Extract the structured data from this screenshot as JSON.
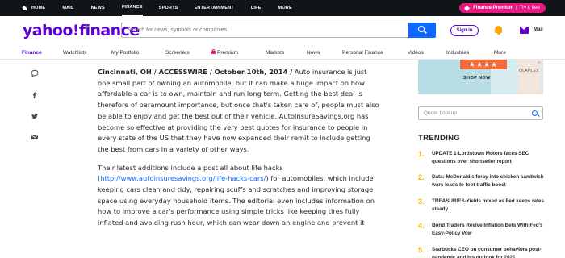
{
  "topbar": {
    "items": [
      "HOME",
      "MAIL",
      "NEWS",
      "FINANCE",
      "SPORTS",
      "ENTERTAINMENT",
      "LIFE",
      "MORE"
    ],
    "active": "FINANCE",
    "premium_label": "Finance Premium",
    "premium_cta": "Try it free"
  },
  "header": {
    "logo": "yahoo!finance",
    "search_placeholder": "Search for news, symbols or companies",
    "signin_label": "Sign in",
    "mail_label": "Mail"
  },
  "subnav": {
    "items": [
      "Finance",
      "Watchlists",
      "My Portfolio",
      "Screeners",
      "Premium",
      "Markets",
      "News",
      "Personal Finance",
      "Videos",
      "Industries",
      "More"
    ],
    "active": "Finance"
  },
  "share_icons": [
    "comment-icon",
    "facebook-icon",
    "twitter-icon",
    "email-icon"
  ],
  "article": {
    "dateline": "Cincinnati, OH / ACCESSWIRE / October 10th, 2014 /",
    "p1": " Auto insurance is just one small part of owning an automobile, but it can make a huge impact on how affordable a car is to own, maintain and run long term. Getting the best deal is therefore of paramount importance, but once that's taken care of, people must also be able to enjoy and get the best out of their vehicle. AutoInsureSavings.org has become so effective at providing the very best quotes for insurance to people in every state of the US that they have now expanded their remit to include getting the best from cars in a variety of other ways.",
    "p2_a": "Their latest additions include a post all about life hacks (",
    "p2_link": "http://www.autoinsuresavings.org/life-hacks-cars/",
    "p2_b": ") for automobiles, which include keeping cars clean and tidy, repairing scuffs and scratches and improving storage space using everyday household items. The editorial even includes information on how to improve a car's performance using simple tricks like keeping tires fully inflated and avoiding rush hour, which can wear down an engine and prevent it"
  },
  "ad": {
    "stars": "★★★★",
    "cta": "SHOP NOW",
    "brand": "OLAPLEX",
    "close": "▷"
  },
  "quote_lookup": {
    "placeholder": "Quote Lookup"
  },
  "trending": {
    "title": "TRENDING",
    "items": [
      {
        "num": "1.",
        "text": "UPDATE 1-Lordstown Motors faces SEC questions over shortseller report"
      },
      {
        "num": "2.",
        "text": "Data: McDonald's foray into chicken sandwich wars leads to foot traffic boost"
      },
      {
        "num": "3.",
        "text": "TREASURIES-Yields mixed as Fed keeps rates steady"
      },
      {
        "num": "4.",
        "text": "Bond Traders Revive Inflation Bets With Fed's Easy-Policy Vow"
      },
      {
        "num": "5.",
        "text": "Starbucks CEO on consumer behaviors post-pandemic and his outlook for 2021"
      }
    ]
  }
}
